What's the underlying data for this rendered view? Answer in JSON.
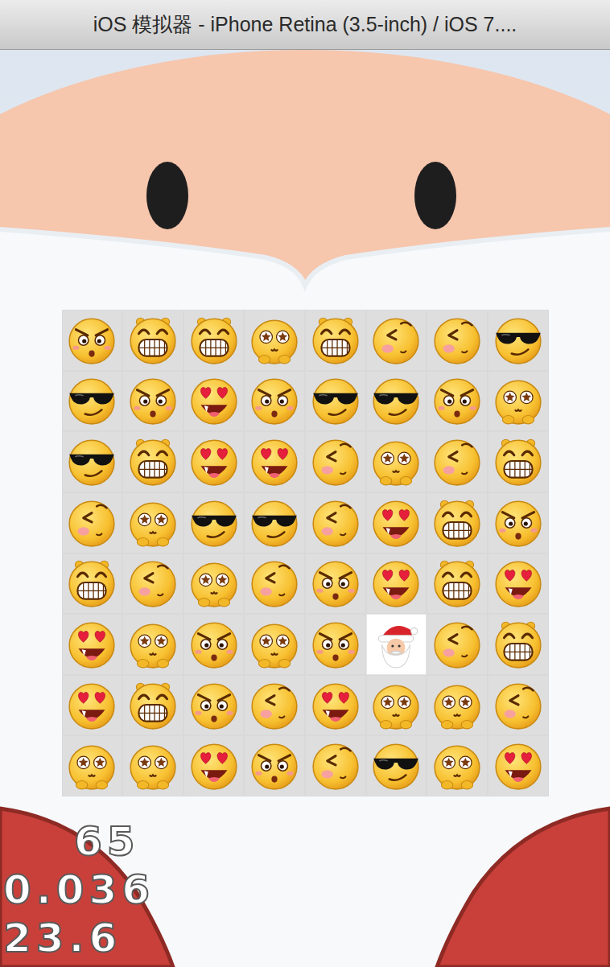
{
  "window": {
    "title": "iOS 模拟器 - iPhone Retina (3.5-inch) / iOS 7...."
  },
  "grid": {
    "rows": [
      [
        {
          "kind": "shocked"
        },
        {
          "kind": "grin"
        },
        {
          "kind": "grin"
        },
        {
          "kind": "dizzy"
        },
        {
          "kind": "grin"
        },
        {
          "kind": "shy"
        },
        {
          "kind": "shy"
        },
        {
          "kind": "cool"
        }
      ],
      [
        {
          "kind": "cool"
        },
        {
          "kind": "shocked"
        },
        {
          "kind": "love"
        },
        {
          "kind": "shocked"
        },
        {
          "kind": "cool"
        },
        {
          "kind": "cool"
        },
        {
          "kind": "shocked"
        },
        {
          "kind": "dizzy"
        }
      ],
      [
        {
          "kind": "cool"
        },
        {
          "kind": "grin"
        },
        {
          "kind": "love"
        },
        {
          "kind": "love"
        },
        {
          "kind": "shy"
        },
        {
          "kind": "dizzy"
        },
        {
          "kind": "shy"
        },
        {
          "kind": "grin"
        }
      ],
      [
        {
          "kind": "shy"
        },
        {
          "kind": "dizzy"
        },
        {
          "kind": "cool"
        },
        {
          "kind": "cool"
        },
        {
          "kind": "shy"
        },
        {
          "kind": "love"
        },
        {
          "kind": "grin"
        },
        {
          "kind": "shocked"
        }
      ],
      [
        {
          "kind": "grin"
        },
        {
          "kind": "shy"
        },
        {
          "kind": "dizzy"
        },
        {
          "kind": "shy"
        },
        {
          "kind": "shocked"
        },
        {
          "kind": "love"
        },
        {
          "kind": "grin"
        },
        {
          "kind": "love"
        }
      ],
      [
        {
          "kind": "love"
        },
        {
          "kind": "dizzy"
        },
        {
          "kind": "shocked"
        },
        {
          "kind": "dizzy"
        },
        {
          "kind": "shocked"
        },
        {
          "kind": "santa"
        },
        {
          "kind": "shy"
        },
        {
          "kind": "grin"
        }
      ],
      [
        {
          "kind": "love"
        },
        {
          "kind": "grin"
        },
        {
          "kind": "shocked"
        },
        {
          "kind": "shy"
        },
        {
          "kind": "love"
        },
        {
          "kind": "dizzy"
        },
        {
          "kind": "dizzy"
        },
        {
          "kind": "shy"
        }
      ],
      [
        {
          "kind": "dizzy"
        },
        {
          "kind": "dizzy"
        },
        {
          "kind": "love"
        },
        {
          "kind": "shocked"
        },
        {
          "kind": "shy"
        },
        {
          "kind": "cool"
        },
        {
          "kind": "dizzy"
        },
        {
          "kind": "love"
        }
      ]
    ]
  },
  "stats": [
    "65",
    "0.036",
    "23.6"
  ]
}
